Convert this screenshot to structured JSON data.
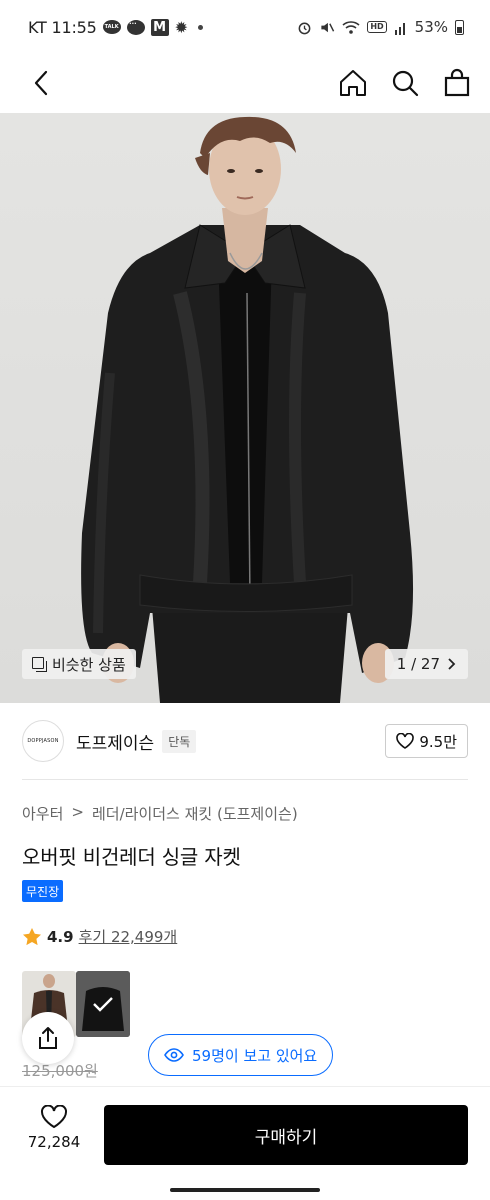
{
  "status_bar": {
    "carrier_time": "KT 11:55",
    "talk_badge": "TALK",
    "m_badge": "M",
    "hd_badge": "HD",
    "battery": "53%",
    "icons": [
      "talk-icon",
      "chat-icon",
      "m-app-icon",
      "bug-icon",
      "alarm-icon",
      "mute-icon",
      "wifi-icon",
      "hd-icon",
      "signal-icon",
      "battery-icon"
    ]
  },
  "nav": {
    "icons": [
      "back-arrow-icon",
      "home-icon",
      "search-icon",
      "shopping-bag-icon"
    ]
  },
  "hero": {
    "similar_label": "비슷한 상품",
    "pager": "1 / 27"
  },
  "brand": {
    "logo_text": "DOPPJASON",
    "name": "도프제이슨",
    "badge": "단독",
    "like_count": "9.5만"
  },
  "breadcrumb": {
    "category": "아우터",
    "separator": ">",
    "subcategory": "레더/라이더스 재킷 (도프제이슨)"
  },
  "product": {
    "title": "오버핏 비건레더 싱글 자켓",
    "delivery_badge": "무진장",
    "rating": "4.9",
    "reviews": "후기 22,499개",
    "price_original": "125,000원"
  },
  "viewers": {
    "label": "59명이 보고 있어요"
  },
  "bottom": {
    "like_count": "72,284",
    "buy_label": "구매하기"
  },
  "colors": {
    "accent_blue": "#0a6cff",
    "star": "#f5a623",
    "buy_button": "#000000"
  }
}
